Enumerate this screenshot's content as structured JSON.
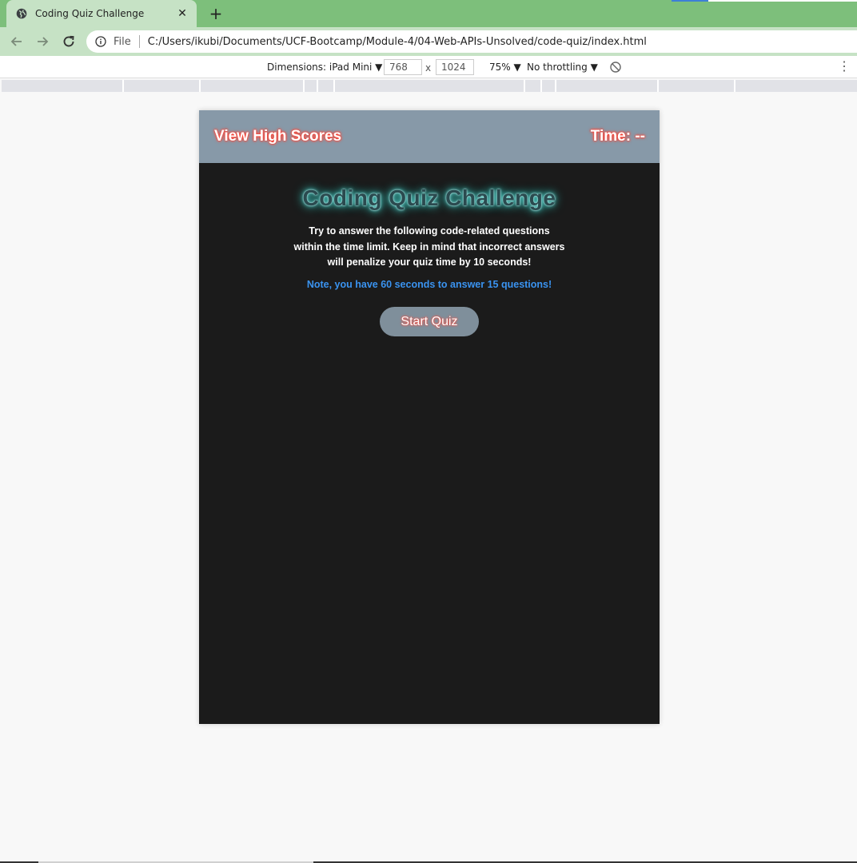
{
  "browser": {
    "tab_title": "Coding Quiz Challenge",
    "tab_close": "✕",
    "new_tab": "+",
    "scheme_label": "File",
    "url": "C:/Users/ikubi/Documents/UCF-Bootcamp/Module-4/04-Web-APIs-Unsolved/code-quiz/index.html"
  },
  "device_toolbar": {
    "dimensions_label": "Dimensions: iPad Mini ▼",
    "width": "768",
    "times": "x",
    "height": "1024",
    "zoom": "75% ▼",
    "throttling": "No throttling ▼",
    "more": "⋮"
  },
  "page": {
    "header": {
      "high_scores": "View High Scores",
      "timer": "Time: --"
    },
    "title": "Coding Quiz Challenge",
    "description": "Try to answer the following code-related questions within the time limit. Keep in mind that incorrect answers will penalize your quiz time by 10 seconds!",
    "note": "Note, you have 60 seconds to answer 15 questions!",
    "start_button": "Start Quiz"
  },
  "colors": {
    "tab_strip": "#7dbf7b",
    "toolbar": "#c6e2c5",
    "page_header": "#8799a8",
    "page_background": "#1b1b1b",
    "note_text": "#3a93f0",
    "button": "#7f8f9b"
  },
  "icons": [
    "globe-icon",
    "close-icon",
    "plus-icon",
    "back-arrow-icon",
    "forward-arrow-icon",
    "reload-icon",
    "info-icon",
    "rotate-disabled-icon",
    "more-vert-icon"
  ]
}
